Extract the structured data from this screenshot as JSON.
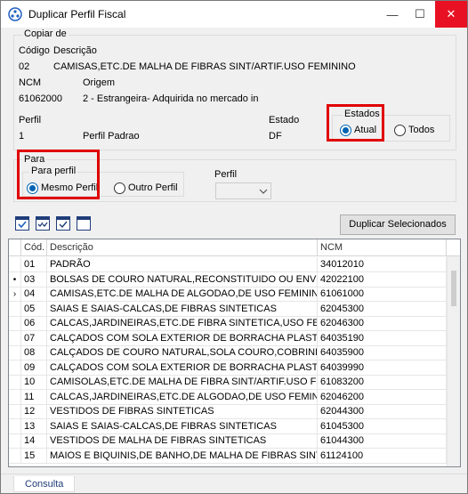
{
  "window": {
    "title": "Duplicar Perfil Fiscal",
    "minimize": "—",
    "maximize": "☐",
    "close": "✕"
  },
  "copiar": {
    "group_label": "Copiar de",
    "codigo_label": "Código",
    "descricao_label": "Descrição",
    "codigo_value": "02",
    "descricao_value": "CAMISAS,ETC.DE MALHA DE FIBRAS SINT/ARTIF.USO FEMININO",
    "ncm_label": "NCM",
    "origem_label": "Origem",
    "ncm_value": "61062000",
    "origem_value": "2 - Estrangeira- Adquirida no mercado in",
    "perfil_label": "Perfil",
    "perfil_code": "1",
    "perfil_name": "Perfil Padrao",
    "estado_label": "Estado",
    "estado_value": "DF",
    "estados_group": "Estados",
    "atual_label": "Atual",
    "todos_label": "Todos"
  },
  "para": {
    "group_label": "Para",
    "para_perfil_group": "Para perfil",
    "mesmo_perfil_label": "Mesmo Perfil",
    "outro_perfil_label": "Outro Perfil",
    "perfil_label": "Perfil",
    "perfil_combo_value": ""
  },
  "toolbar": {
    "duplicate_button": "Duplicar Selecionados"
  },
  "grid": {
    "headers": {
      "cod": "Cód.",
      "descricao": "Descrição",
      "ncm": "NCM"
    },
    "rows": [
      {
        "indicator": "",
        "cod": "01",
        "descricao": "PADRÃO",
        "ncm": "34012010"
      },
      {
        "indicator": "•",
        "cod": "03",
        "descricao": "BOLSAS DE COURO NATURAL,RECONSTITUIDO OU ENVERNIZADO",
        "ncm": "42022100"
      },
      {
        "indicator": "›",
        "cod": "04",
        "descricao": "CAMISAS,ETC.DE MALHA DE ALGODAO,DE USO FEMININO",
        "ncm": "61061000"
      },
      {
        "indicator": "",
        "cod": "05",
        "descricao": "SAIAS E SAIAS-CALCAS,DE FIBRAS SINTETICAS",
        "ncm": "62045300"
      },
      {
        "indicator": "",
        "cod": "06",
        "descricao": "CALCAS,JARDINEIRAS,ETC.DE FIBRA SINTETICA,USO FEMININO",
        "ncm": "62046300"
      },
      {
        "indicator": "",
        "cod": "07",
        "descricao": "CALÇADOS COM SOLA EXTERIOR DE BORRACHA PLASTICOS OU",
        "ncm": "64035190"
      },
      {
        "indicator": "",
        "cod": "08",
        "descricao": "CALÇADOS DE COURO NATURAL,SOLA COURO,COBRINDO TORNOZELO",
        "ncm": "64035900"
      },
      {
        "indicator": "",
        "cod": "09",
        "descricao": "CALÇADOS COM SOLA EXTERIOR DE BORRACHA PLASTICOS OU",
        "ncm": "64039990"
      },
      {
        "indicator": "",
        "cod": "10",
        "descricao": "CAMISOLAS,ETC.DE MALHA DE FIBRA SINT/ARTIF.USO FEMININO",
        "ncm": "61083200"
      },
      {
        "indicator": "",
        "cod": "11",
        "descricao": "CALCAS,JARDINEIRAS,ETC.DE ALGODAO,DE USO FEMININO",
        "ncm": "62046200"
      },
      {
        "indicator": "",
        "cod": "12",
        "descricao": "VESTIDOS DE FIBRAS SINTETICAS",
        "ncm": "62044300"
      },
      {
        "indicator": "",
        "cod": "13",
        "descricao": "SAIAS E SAIAS-CALCAS,DE FIBRAS SINTETICAS",
        "ncm": "61045300"
      },
      {
        "indicator": "",
        "cod": "14",
        "descricao": "VESTIDOS DE MALHA DE FIBRAS SINTETICAS",
        "ncm": "61044300"
      },
      {
        "indicator": "",
        "cod": "15",
        "descricao": "MAIOS E BIQUINIS,DE BANHO,DE MALHA DE FIBRAS SINTETICAS",
        "ncm": "61124100"
      }
    ]
  },
  "status": {
    "tab_label": "Consulta"
  },
  "colors": {
    "accent": "#0063b1",
    "highlight": "#e00000",
    "close": "#e81123"
  }
}
